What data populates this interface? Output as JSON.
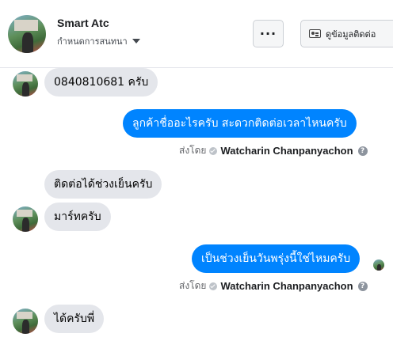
{
  "header": {
    "title": "Smart Atc",
    "subtitle": "กำหนดการสนทนา",
    "more_label": "···",
    "contact_label": "ดูข้อมูลติดต่อ"
  },
  "messages": [
    {
      "side": "in",
      "text": "0840810681 ครับ"
    },
    {
      "side": "out",
      "text": "ลูกค้าชื่ออะไรครับ สะดวกติดต่อเวลาไหนครับ"
    },
    {
      "side": "in",
      "text": "ติดต่อได้ช่วงเย็นครับ"
    },
    {
      "side": "in",
      "text": "มาร์ทครับ"
    },
    {
      "side": "out",
      "text": "เป็นช่วงเย็นวันพรุ่งนี้ใช่ไหมครับ"
    },
    {
      "side": "in",
      "text": "ได้ครับพี่"
    }
  ],
  "sent_by": {
    "prefix": "ส่งโดย",
    "name": "Watcharin Chanpanyachon",
    "help": "?"
  },
  "colors": {
    "outgoing": "#0084ff",
    "incoming": "#e4e6eb"
  },
  "icons": [
    "more-dots-icon",
    "contact-card-icon",
    "check-icon",
    "help-icon",
    "caret-down-icon"
  ]
}
